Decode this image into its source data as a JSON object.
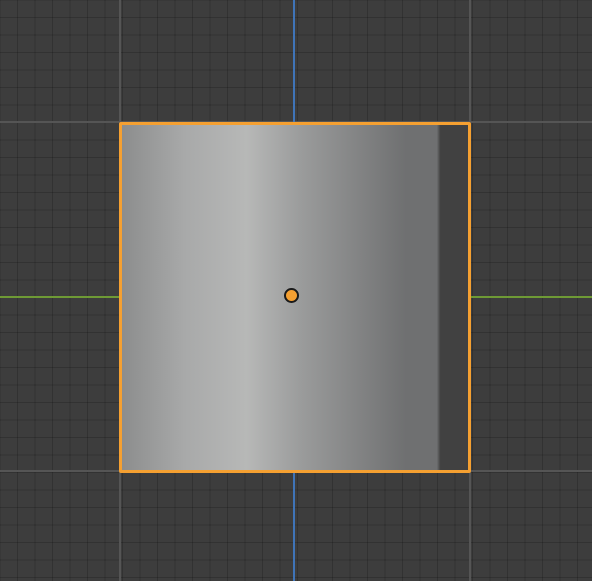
{
  "viewport": {
    "background_color": "#3d3d3d",
    "grid_minor_color": "#333333",
    "grid_major_color": "#555555"
  },
  "axes": {
    "x_axis_color": "#6e9a35",
    "y_axis_color": "#3f74b8"
  },
  "object": {
    "type": "cylinder",
    "selected": true,
    "selection_outline_color": "#f5a031",
    "origin_color": "#f5a031",
    "shading": [
      "#8c8d8d",
      "#a8a9a9",
      "#b7b8b7",
      "#9a9b9b",
      "#6f7071",
      "#414141"
    ]
  }
}
